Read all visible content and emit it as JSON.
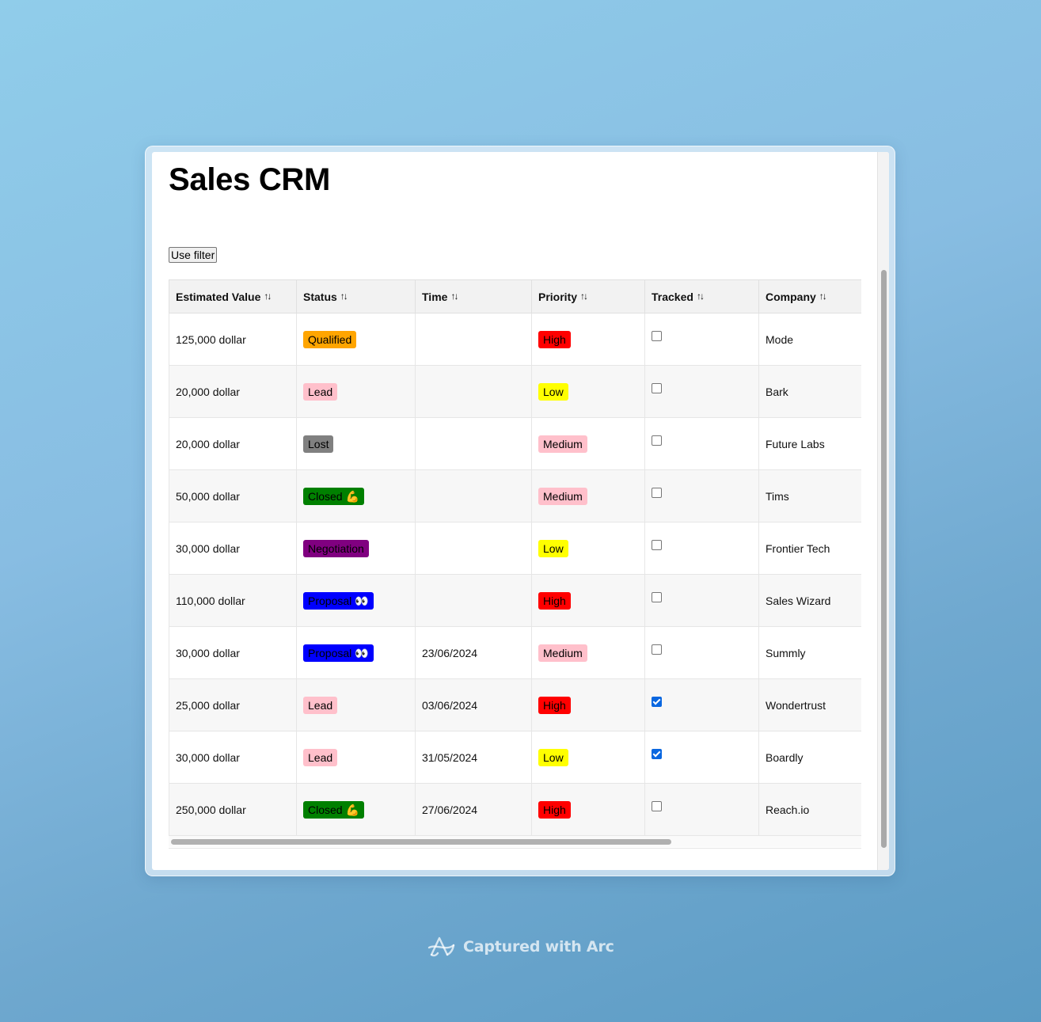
{
  "page": {
    "title": "Sales CRM",
    "filter_button": "Use filter"
  },
  "columns": [
    "Estimated Value",
    "Status",
    "Time",
    "Priority",
    "Tracked",
    "Company"
  ],
  "sort_icon": "sort-arrows-icon",
  "status_colors": {
    "Qualified": "#ffa500",
    "Lead": "#ffc0cb",
    "Lost": "#808080",
    "Closed": "#008000",
    "Negotiation": "#800080",
    "Proposal": "#0000ff"
  },
  "priority_colors": {
    "High": "#ff0000",
    "Medium": "#ffc0cb",
    "Low": "#ffff00"
  },
  "rows": [
    {
      "value": "125,000 dollar",
      "status": "Qualified",
      "status_key": "Qualified",
      "time": "",
      "priority": "High",
      "tracked": false,
      "company": "Mode"
    },
    {
      "value": "20,000 dollar",
      "status": "Lead",
      "status_key": "Lead",
      "time": "",
      "priority": "Low",
      "tracked": false,
      "company": "Bark"
    },
    {
      "value": "20,000 dollar",
      "status": "Lost",
      "status_key": "Lost",
      "time": "",
      "priority": "Medium",
      "tracked": false,
      "company": "Future Labs"
    },
    {
      "value": "50,000 dollar",
      "status": "Closed 💪",
      "status_key": "Closed",
      "time": "",
      "priority": "Medium",
      "tracked": false,
      "company": "Tims"
    },
    {
      "value": "30,000 dollar",
      "status": "Negotiation",
      "status_key": "Negotiation",
      "time": "",
      "priority": "Low",
      "tracked": false,
      "company": "Frontier Tech"
    },
    {
      "value": "110,000 dollar",
      "status": "Proposal 👀",
      "status_key": "Proposal",
      "time": "",
      "priority": "High",
      "tracked": false,
      "company": "Sales Wizard"
    },
    {
      "value": "30,000 dollar",
      "status": "Proposal 👀",
      "status_key": "Proposal",
      "time": "23/06/2024",
      "priority": "Medium",
      "tracked": false,
      "company": "Summly"
    },
    {
      "value": "25,000 dollar",
      "status": "Lead",
      "status_key": "Lead",
      "time": "03/06/2024",
      "priority": "High",
      "tracked": true,
      "company": "Wondertrust"
    },
    {
      "value": "30,000 dollar",
      "status": "Lead",
      "status_key": "Lead",
      "time": "31/05/2024",
      "priority": "Low",
      "tracked": true,
      "company": "Boardly"
    },
    {
      "value": "250,000 dollar",
      "status": "Closed 💪",
      "status_key": "Closed",
      "time": "27/06/2024",
      "priority": "High",
      "tracked": false,
      "company": "Reach.io"
    }
  ],
  "footer": {
    "caption": "Captured with Arc",
    "icon": "arc-logo-icon"
  }
}
